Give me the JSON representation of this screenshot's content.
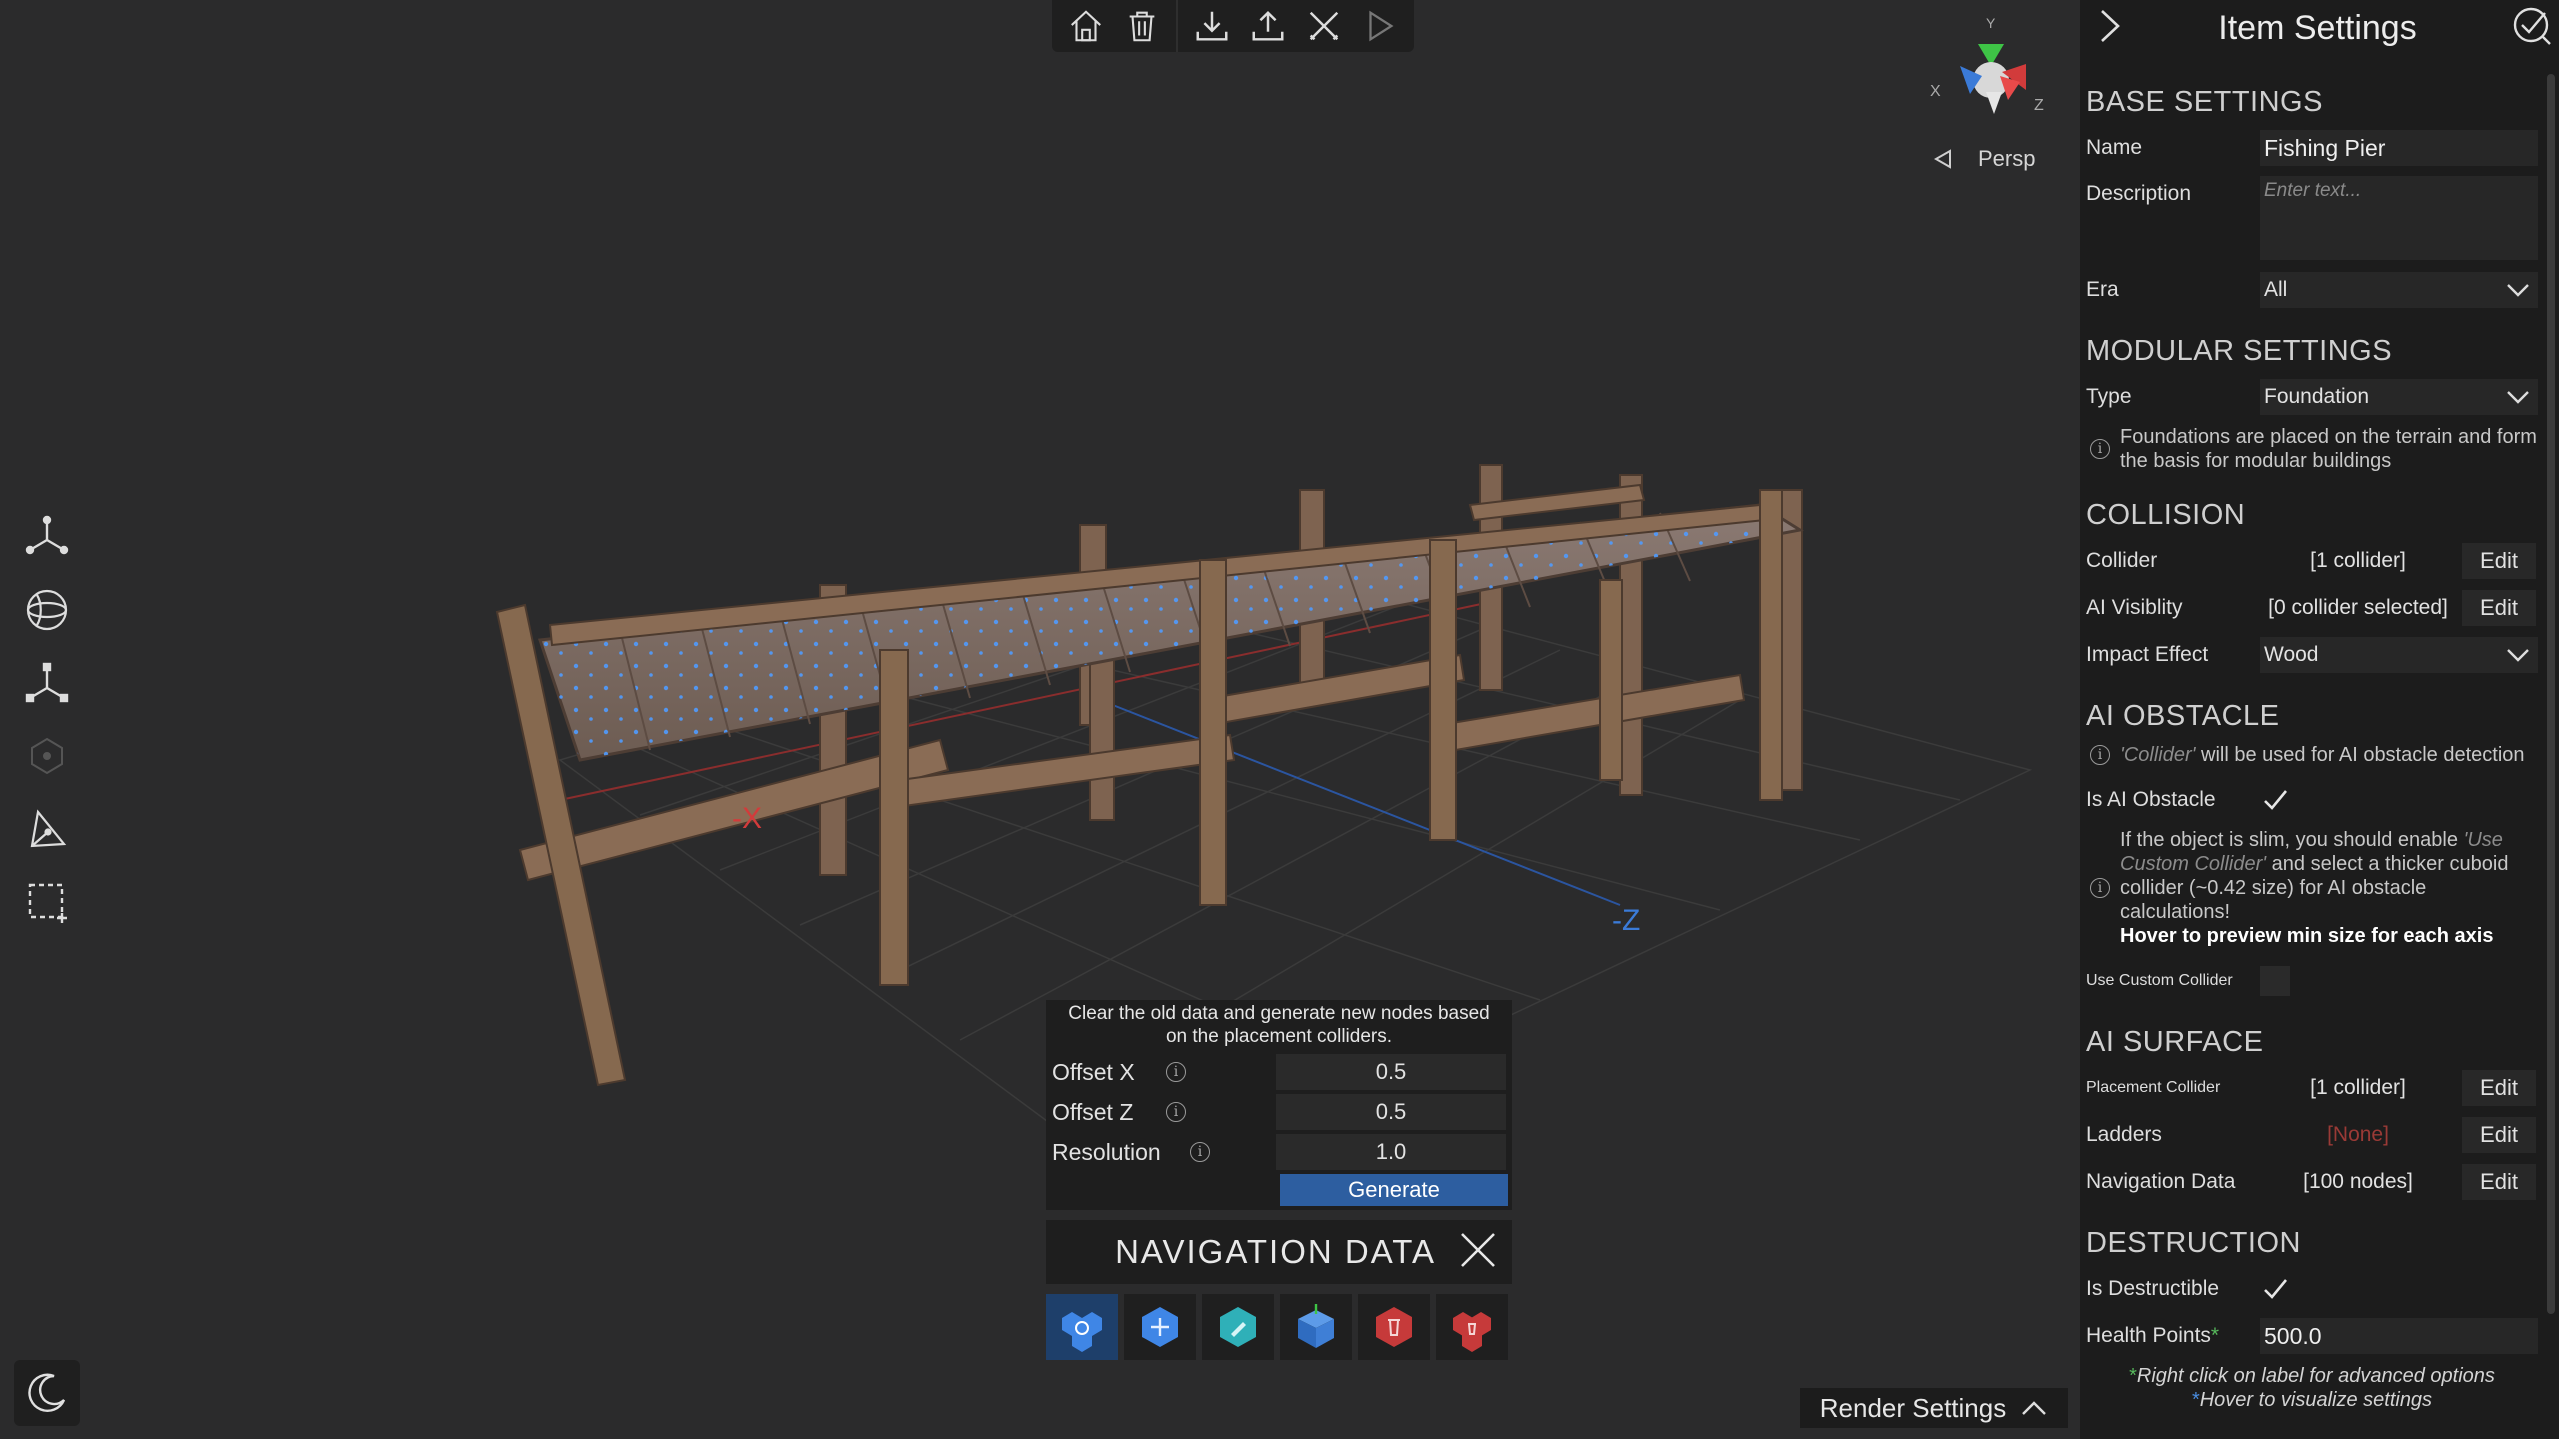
{
  "toolbar": {
    "buttons": [
      "home-icon",
      "trash-icon",
      "download-icon",
      "upload-icon",
      "scissors-icon",
      "play-icon"
    ]
  },
  "viewport": {
    "axis_neg_x": "-X",
    "axis_neg_z": "-Z",
    "view_mode": "Persp",
    "gizmo": {
      "x": "X",
      "y": "Y",
      "z": "Z"
    },
    "left_tools": [
      "move-axes-icon",
      "rotate-sphere-icon",
      "scale-axes-icon",
      "pivot-hex-icon",
      "snap-triangle-icon",
      "select-rect-icon"
    ]
  },
  "nav_panel": {
    "description": "Clear the old data and generate new nodes based on the placement colliders.",
    "params": [
      {
        "label": "Offset X",
        "value": "0.5"
      },
      {
        "label": "Offset Z",
        "value": "0.5"
      },
      {
        "label": "Resolution",
        "value": "1.0"
      }
    ],
    "generate_label": "Generate",
    "title": "NAVIGATION DATA"
  },
  "render_settings_label": "Render Settings",
  "panel": {
    "title": "Item Settings",
    "base": {
      "header": "BASE SETTINGS",
      "name_label": "Name",
      "name_value": "Fishing Pier",
      "description_label": "Description",
      "description_placeholder": "Enter text...",
      "era_label": "Era",
      "era_value": "All"
    },
    "modular": {
      "header": "MODULAR SETTINGS",
      "type_label": "Type",
      "type_value": "Foundation",
      "note": "Foundations are placed on the terrain and form the basis for modular buildings"
    },
    "collision": {
      "header": "COLLISION",
      "collider_label": "Collider",
      "collider_value": "[1 collider]",
      "ai_visibility_label": "AI Visiblity",
      "ai_visibility_value": "[0 collider selected]",
      "impact_label": "Impact Effect",
      "impact_value": "Wood",
      "edit_label": "Edit"
    },
    "ai_obstacle": {
      "header": "AI OBSTACLE",
      "note_hint": "'Collider'",
      "note_rest": " will be used for AI obstacle detection",
      "is_obstacle_label": "Is AI Obstacle",
      "slim_note_1": "If the object is slim, you should enable ",
      "slim_note_hint": "'Use Custom Collider'",
      "slim_note_2": " and select a thicker cuboid collider (~0.42 size) for AI obstacle calculations!",
      "slim_note_bold": "Hover to preview min size for each axis",
      "custom_collider_label": "Use Custom Collider"
    },
    "ai_surface": {
      "header": "AI SURFACE",
      "placement_label": "Placement Collider",
      "placement_value": "[1 collider]",
      "ladders_label": "Ladders",
      "ladders_value": "[None]",
      "navdata_label": "Navigation Data",
      "navdata_value": "[100 nodes]"
    },
    "destruction": {
      "header": "DESTRUCTION",
      "destructible_label": "Is Destructible",
      "hp_label": "Health Points",
      "hp_value": "500.0"
    },
    "footnote_1": "Right click on label for advanced options",
    "footnote_2": "Hover to visualize settings"
  },
  "colors": {
    "accent_blue": "#2d5ea0",
    "axis_x": "#d23b3b",
    "axis_y": "#3ec446",
    "axis_z": "#3b7bd8",
    "wood": "#8a6c55"
  }
}
